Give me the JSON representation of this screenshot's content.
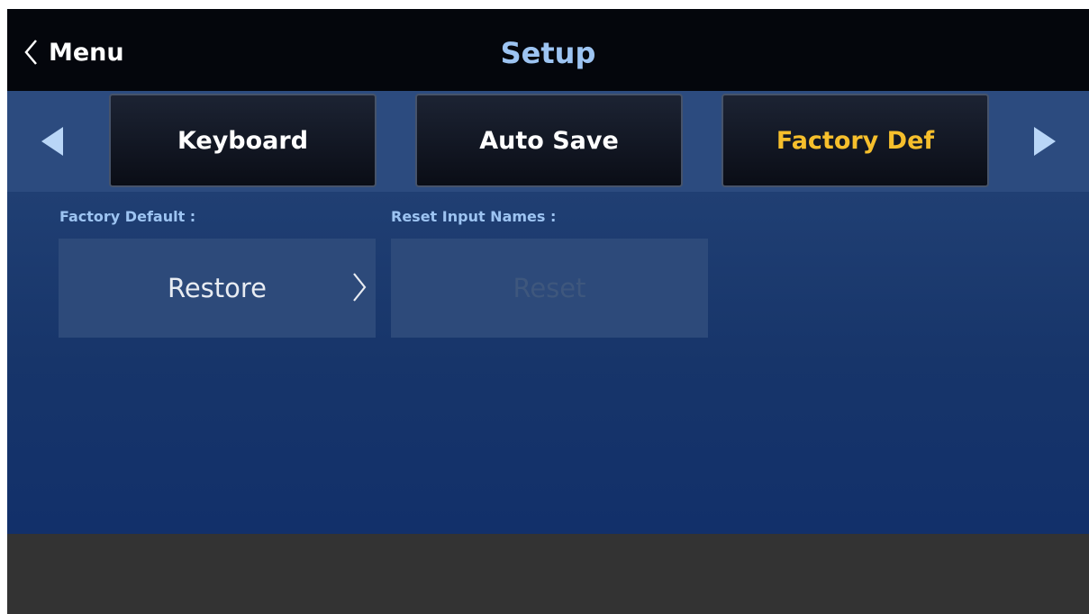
{
  "header": {
    "back_label": "Menu",
    "back_icon": "chevron-left-icon",
    "title": "Setup"
  },
  "tabs": {
    "prev_icon": "triangle-left-icon",
    "next_icon": "triangle-right-icon",
    "items": [
      {
        "label": "Keyboard",
        "active": false
      },
      {
        "label": "Auto Save",
        "active": false
      },
      {
        "label": "Factory Def",
        "active": true
      }
    ]
  },
  "content": {
    "factory_default": {
      "label": "Factory Default :",
      "button_label": "Restore",
      "button_icon": "chevron-right-icon"
    },
    "reset_input_names": {
      "label": "Reset Input Names :",
      "button_label": "Reset",
      "enabled": false
    }
  },
  "colors": {
    "header_bg": "#04060c",
    "title": "#9dc4f2",
    "tabbar_bg": "#2c4b7f",
    "active_tab_text": "#f6bf2c",
    "content_bg": "#17356a",
    "button_bg": "#2d4a7a",
    "disabled_text": "#3e577d",
    "footer_bg": "#333333"
  }
}
